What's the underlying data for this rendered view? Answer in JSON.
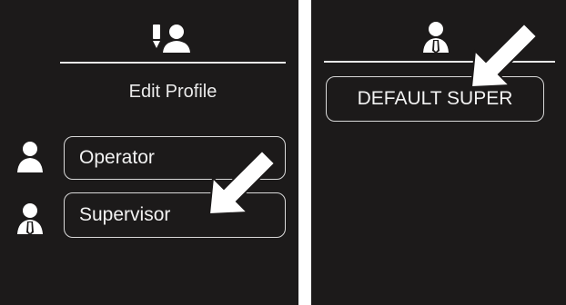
{
  "left_screen": {
    "header_icon": "edit-profile-icon",
    "title": "Edit Profile",
    "items": [
      {
        "label": "Operator",
        "icon": "operator-icon"
      },
      {
        "label": "Supervisor",
        "icon": "supervisor-icon"
      }
    ],
    "pointer": "arrow-pointer-icon"
  },
  "right_screen": {
    "header_icon": "supervisor-icon",
    "items": [
      {
        "label": "DEFAULT SUPER"
      }
    ],
    "pointer": "arrow-pointer-icon"
  }
}
